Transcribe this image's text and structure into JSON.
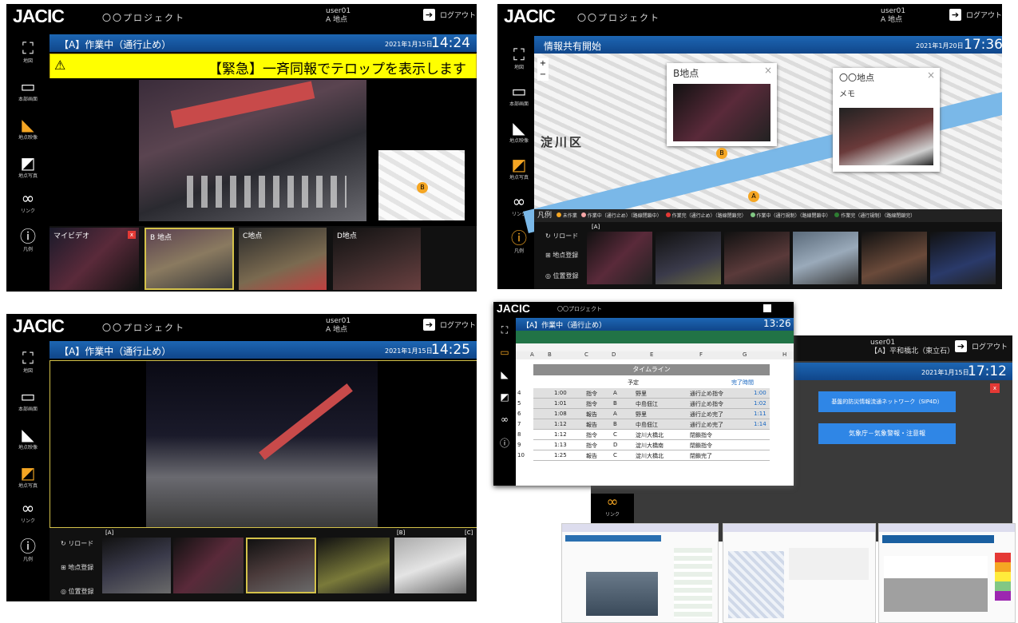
{
  "app": {
    "logo": "JACIC",
    "project": "〇〇プロジェクト",
    "logout": "ログアウト"
  },
  "sidebar": [
    {
      "label": "地図",
      "icon": "map-icon"
    },
    {
      "label": "本部画面",
      "icon": "monitor-icon"
    },
    {
      "label": "地点映像",
      "icon": "camera-icon"
    },
    {
      "label": "地点写真",
      "icon": "photo-icon"
    },
    {
      "label": "リンク",
      "icon": "link-icon"
    },
    {
      "label": "凡例",
      "icon": "info-icon"
    }
  ],
  "tl": {
    "user": "user01",
    "location": "A 地点",
    "status": "【A】作業中（通行止め）",
    "date": "2021年1月15日",
    "time": "14:24",
    "alert_icon": "⚠",
    "alert": "【緊急】一斉同報でテロップを表示します",
    "thumbs": [
      {
        "label": "マイビデオ"
      },
      {
        "label": "B 地点"
      },
      {
        "label": "C地点"
      },
      {
        "label": "D地点"
      }
    ],
    "map_marker": "B"
  },
  "tr": {
    "user": "user01",
    "location": "A 地点",
    "status": "情報共有開始",
    "date": "2021年1月20日",
    "time": "17:36",
    "popup1_title": "B地点",
    "popup2_title": "〇〇地点",
    "popup2_memo": "メモ",
    "ward": "淀川区",
    "marker_b": "B",
    "marker_a": "A",
    "legend_title": "凡例",
    "legend": [
      {
        "text": "未作業",
        "color": "#f5a623"
      },
      {
        "text": "作業中（通行止め）（路線閉鎖中）",
        "color": "#f7a6a6"
      },
      {
        "text": "作業完（通行止め）（路線閉鎖完）",
        "color": "#e53935"
      },
      {
        "text": "作業中（通行規制）（路線閉鎖中）",
        "color": "#81c784"
      },
      {
        "text": "作業完（通行規制）（路線閉鎖完）",
        "color": "#2e7d32"
      }
    ],
    "reload": "リロード",
    "register_point": "地点登録",
    "register_position": "位置登録",
    "group": "[A]"
  },
  "bl": {
    "user": "user01",
    "location": "A 地点",
    "status": "【A】作業中（通行止め）",
    "date": "2021年1月15日",
    "time": "14:25",
    "reload": "リロード",
    "register_point": "地点登録",
    "register_position": "位置登録",
    "group_a": "[A]",
    "group_b": "[B]",
    "group_c": "[C]"
  },
  "br": {
    "back_user": "user01",
    "back_location": "【A】平和橋北（東立石）",
    "back_date": "2021年1月15日",
    "back_time": "17:12",
    "buttons": [
      "基盤的防災情報流通ネットワーク（SIP4D）",
      "気象庁－気象警報・注意報"
    ],
    "close": "x",
    "front_status": "【A】作業中（通行止め）",
    "front_time": "13:26",
    "sheet_title": "タイムライン",
    "col_plan": "予定",
    "col_done": "完了時間",
    "col_letters": [
      "A",
      "B",
      "C",
      "D",
      "E",
      "F",
      "G",
      "H"
    ],
    "rows": [
      {
        "n": "4",
        "time": "1:00",
        "type": "指令",
        "pt": "A",
        "place": "野里",
        "act": "通行止め指令",
        "done": "1:00"
      },
      {
        "n": "5",
        "time": "1:01",
        "type": "指令",
        "pt": "B",
        "place": "中島佃江",
        "act": "通行止め指令",
        "done": "1:02"
      },
      {
        "n": "6",
        "time": "1:08",
        "type": "報告",
        "pt": "A",
        "place": "野里",
        "act": "通行止め完了",
        "done": "1:11"
      },
      {
        "n": "7",
        "time": "1:12",
        "type": "報告",
        "pt": "B",
        "place": "中島佃江",
        "act": "通行止め完了",
        "done": "1:14"
      },
      {
        "n": "8",
        "time": "1:12",
        "type": "指令",
        "pt": "C",
        "place": "淀川大橋北",
        "act": "閉鎖指令",
        "done": ""
      },
      {
        "n": "9",
        "time": "1:13",
        "type": "指令",
        "pt": "D",
        "place": "淀川大橋南",
        "act": "閉鎖指令",
        "done": ""
      },
      {
        "n": "10",
        "time": "1:25",
        "type": "報告",
        "pt": "C",
        "place": "淀川大橋北",
        "act": "閉鎖完了",
        "done": ""
      }
    ],
    "link_label": "リンク"
  }
}
